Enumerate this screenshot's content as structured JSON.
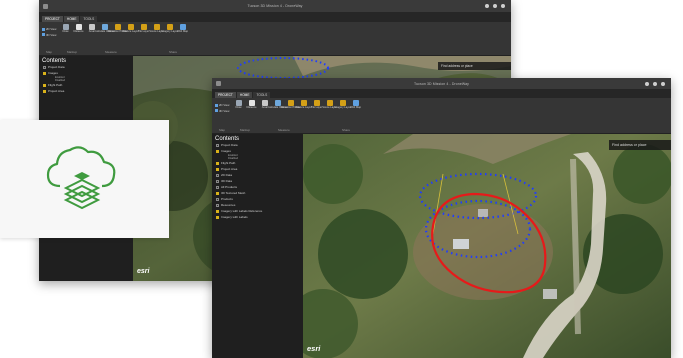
{
  "back_window": {
    "title": "Tucson 3D Mission 4 - DroneWay",
    "tabs": [
      "PROJECT",
      "HOME",
      "TOOLS"
    ],
    "view_toggles": [
      "2D View",
      "3D View"
    ],
    "tools": [
      {
        "label": "Draw",
        "icon": "draw-icon",
        "color": "#9aa7b5"
      },
      {
        "label": "Distance",
        "icon": "distance-icon",
        "color": "#e4e4e4"
      },
      {
        "label": "Area",
        "icon": "area-icon",
        "color": "#c8c8c8"
      },
      {
        "label": "Calculate Volume",
        "icon": "volume-icon",
        "color": "#6ea8dc"
      },
      {
        "label": "Elevation Profile",
        "icon": "elevation-profile-icon",
        "color": "#d4a017"
      },
      {
        "label": "Feature Layer",
        "icon": "feature-layer-icon",
        "color": "#d4a017"
      },
      {
        "label": "Tile Layer",
        "icon": "tile-layer-icon",
        "color": "#d4a017"
      },
      {
        "label": "Scene Layer",
        "icon": "scene-layer-icon",
        "color": "#d4a017"
      },
      {
        "label": "Imagery Layer",
        "icon": "imagery-layer-icon",
        "color": "#d4a017"
      },
      {
        "label": "Web Map",
        "icon": "web-map-icon",
        "color": "#5fa0e0"
      }
    ],
    "ribbon_groups": [
      "Map",
      "Markup",
      "Measure",
      "Share"
    ],
    "contents_title": "Contents",
    "tree": [
      {
        "label": "Project Data",
        "checked": false,
        "sub": false
      },
      {
        "label": "Images",
        "checked": true,
        "sub": false
      },
      {
        "label": "Enabled",
        "sub": true
      },
      {
        "label": "Disabled",
        "sub": true
      },
      {
        "label": "Flight Path",
        "checked": true,
        "sub": false
      },
      {
        "label": "Project Area",
        "checked": true,
        "sub": false
      }
    ],
    "search_placeholder": "Find address or place",
    "logo_text": "esri"
  },
  "front_window": {
    "title": "Tucson 3D Mission 4 - DroneWay",
    "tabs": [
      "PROJECT",
      "HOME",
      "TOOLS"
    ],
    "view_toggles": [
      "2D View",
      "3D View"
    ],
    "tools": [
      {
        "label": "Draw",
        "icon": "draw-icon",
        "color": "#9aa7b5"
      },
      {
        "label": "Distance",
        "icon": "distance-icon",
        "color": "#e4e4e4"
      },
      {
        "label": "Area",
        "icon": "area-icon",
        "color": "#c8c8c8"
      },
      {
        "label": "Calculate Volume",
        "icon": "volume-icon",
        "color": "#6ea8dc"
      },
      {
        "label": "Elevation Profile",
        "icon": "elevation-profile-icon",
        "color": "#d4a017"
      },
      {
        "label": "Feature Layer",
        "icon": "feature-layer-icon",
        "color": "#d4a017"
      },
      {
        "label": "Tile Layer",
        "icon": "tile-layer-icon",
        "color": "#d4a017"
      },
      {
        "label": "Scene Layer",
        "icon": "scene-layer-icon",
        "color": "#d4a017"
      },
      {
        "label": "Imagery Layer",
        "icon": "imagery-layer-icon",
        "color": "#d4a017"
      },
      {
        "label": "Web Map",
        "icon": "web-map-icon",
        "color": "#5fa0e0"
      }
    ],
    "ribbon_groups": [
      "Map",
      "Markup",
      "Measure",
      "Share"
    ],
    "contents_title": "Contents",
    "tree": [
      {
        "label": "Project Data",
        "checked": false,
        "sub": false
      },
      {
        "label": "Images",
        "checked": true,
        "sub": false
      },
      {
        "label": "Enabled",
        "sub": true
      },
      {
        "label": "Disabled",
        "sub": true
      },
      {
        "label": "Flight Path",
        "checked": true,
        "sub": false
      },
      {
        "label": "Project Area",
        "checked": true,
        "sub": false
      },
      {
        "label": "2D Data",
        "checked": false,
        "sub": false
      },
      {
        "label": "3D Data",
        "checked": false,
        "sub": false
      },
      {
        "label": "All Products",
        "checked": false,
        "sub": false
      },
      {
        "label": "3D Textured Mesh",
        "checked": true,
        "sub": false
      },
      {
        "label": "Products",
        "checked": false,
        "sub": false
      },
      {
        "label": "Resources",
        "checked": false,
        "sub": false
      },
      {
        "label": "Imagery with Labels Reference",
        "checked": true,
        "sub": false
      },
      {
        "label": "Imagery with Labels",
        "checked": true,
        "sub": false
      }
    ],
    "search_placeholder": "Find address or place",
    "logo_text": "esri"
  },
  "colors": {
    "flight_path": "#1f3cff",
    "project_area": "#e61a1a",
    "accent_yellow": "#d9b21a",
    "logo_green": "#3f9b3f"
  },
  "logo_card": {
    "icon": "drone-cloud-logo-icon"
  }
}
